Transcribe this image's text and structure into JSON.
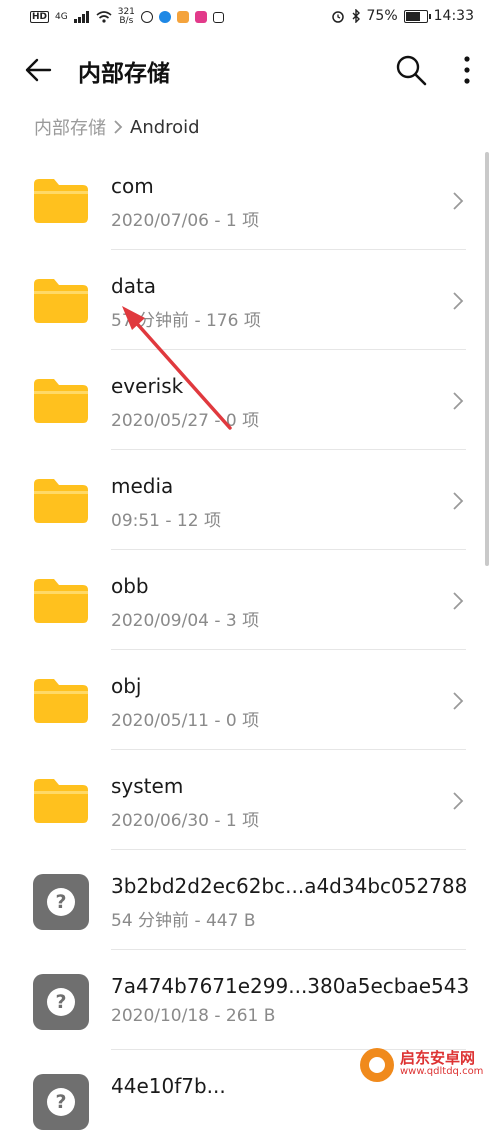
{
  "status": {
    "hd": "HD",
    "net": "4G",
    "speed_value": "321",
    "speed_unit": "B/s",
    "battery": "75%",
    "battery_level": 0.75,
    "time": "14:33"
  },
  "header": {
    "title": "内部存储",
    "back_icon": "arrow-left-icon",
    "search_icon": "search-icon",
    "more_icon": "more-vertical-icon"
  },
  "breadcrumb": {
    "root": "内部存储",
    "current": "Android"
  },
  "items": [
    {
      "name": "com",
      "meta": "2020/07/06 - 1 项",
      "type": "folder"
    },
    {
      "name": "data",
      "meta": "57 分钟前 - 176 项",
      "type": "folder"
    },
    {
      "name": "everisk",
      "meta": "2020/05/27 - 0 项",
      "type": "folder"
    },
    {
      "name": "media",
      "meta": "09:51 - 12 项",
      "type": "folder"
    },
    {
      "name": "obb",
      "meta": "2020/09/04 - 3 项",
      "type": "folder"
    },
    {
      "name": "obj",
      "meta": "2020/05/11 - 0 项",
      "type": "folder"
    },
    {
      "name": "system",
      "meta": "2020/06/30 - 1 项",
      "type": "folder"
    },
    {
      "name": "3b2bd2d2ec62bc...a4d34bc052788",
      "meta": "54 分钟前 - 447 B",
      "type": "file"
    },
    {
      "name": "7a474b7671e299...380a5ecbae543",
      "meta": "2020/10/18 - 261 B",
      "type": "file"
    },
    {
      "name": "44e10f7b...",
      "meta": "",
      "type": "file"
    }
  ],
  "colors": {
    "folder": "#FFC11E",
    "folder_tab": "#FFD966",
    "file_icon": "#6F6F6F",
    "annotation_arrow": "#E0393E"
  },
  "watermark": {
    "brand": "启东安卓网",
    "url": "www.qdltdq.com"
  }
}
